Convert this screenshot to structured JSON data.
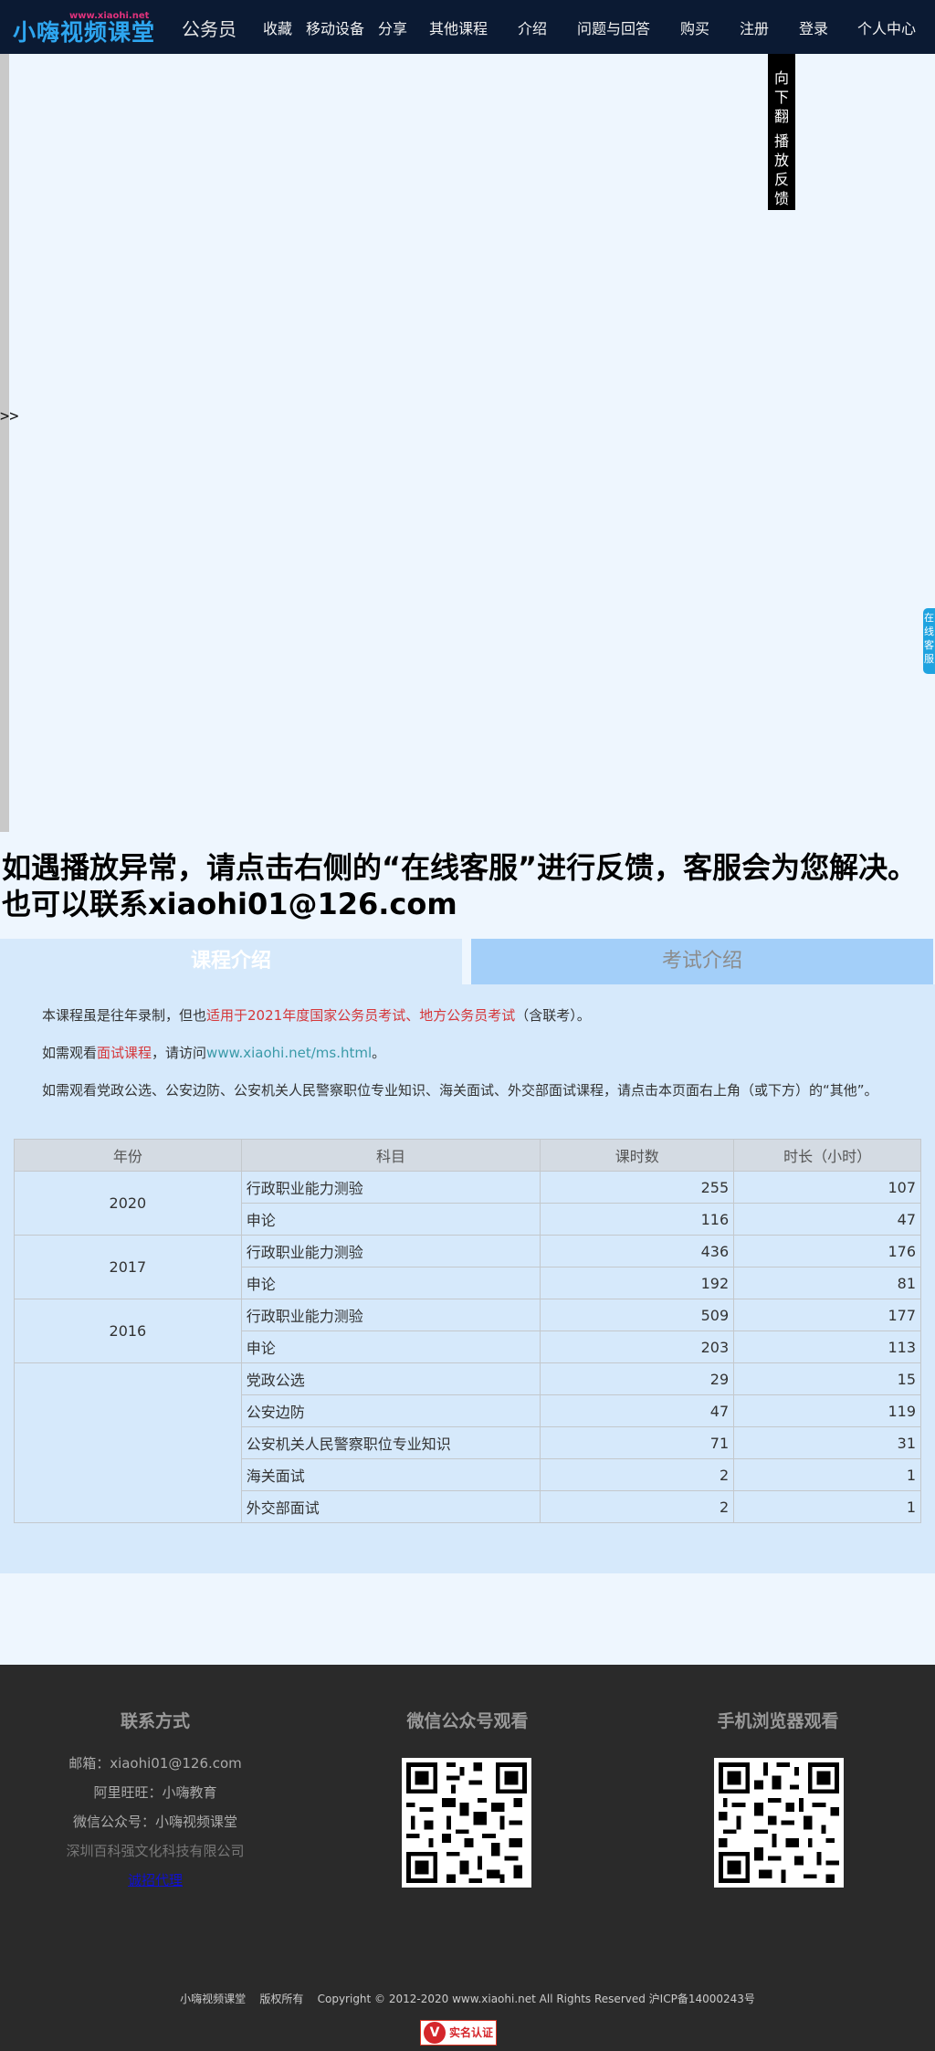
{
  "header": {
    "logo_text": "小嗨视频课堂",
    "logo_url": "www.xiaohi.net",
    "category": "公务员",
    "nav": [
      "收藏",
      "移动设备",
      "分享",
      "其他课程",
      "介绍",
      "问题与回答",
      "购买",
      "注册",
      "登录",
      "个人中心"
    ]
  },
  "player": {
    "toggle": ">>",
    "side_menu": [
      "向下翻",
      "播放反馈"
    ],
    "online_service": "在线客服"
  },
  "notice": {
    "line1": "如遇播放异常，请点击右侧的“在线客服”进行反馈，客服会为您解决。",
    "line2": "也可以联系xiaohi01@126.com"
  },
  "tabs": {
    "course": "课程介绍",
    "exam": "考试介绍"
  },
  "intro": {
    "p1_pre": "本课程虽是往年录制，但也",
    "p1_red": "适用于2021年度国家公务员考试、地方公务员考试",
    "p1_post": "（含联考）。",
    "p2_pre": "如需观看",
    "p2_red": "面试课程",
    "p2_mid": "，请访问",
    "p2_link": "www.xiaohi.net/ms.html",
    "p2_post": "。",
    "p3": "如需观看党政公选、公安边防、公安机关人民警察职位专业知识、海关面试、外交部面试课程，请点击本页面右上角（或下方）的“其他”。"
  },
  "table": {
    "headers": [
      "年份",
      "科目",
      "课时数",
      "时长（小时）"
    ],
    "groups": [
      {
        "year": "2020",
        "rows": [
          [
            "行政职业能力测验",
            "255",
            "107"
          ],
          [
            "申论",
            "116",
            "47"
          ]
        ]
      },
      {
        "year": "2017",
        "rows": [
          [
            "行政职业能力测验",
            "436",
            "176"
          ],
          [
            "申论",
            "192",
            "81"
          ]
        ]
      },
      {
        "year": "2016",
        "rows": [
          [
            "行政职业能力测验",
            "509",
            "177"
          ],
          [
            "申论",
            "203",
            "113"
          ]
        ]
      },
      {
        "year": "",
        "rows": [
          [
            "党政公选",
            "29",
            "15"
          ],
          [
            "公安边防",
            "47",
            "119"
          ],
          [
            "公安机关人民警察职位专业知识",
            "71",
            "31"
          ],
          [
            "海关面试",
            "2",
            "1"
          ],
          [
            "外交部面试",
            "2",
            "1"
          ]
        ]
      }
    ]
  },
  "footer": {
    "contact_title": "联系方式",
    "email": "邮箱：xiaohi01@126.com",
    "wangwang": "阿里旺旺：小嗨教育",
    "wechat": "微信公众号：小嗨视频课堂",
    "company": "深圳百科强文化科技有限公司",
    "agent": "诚招代理",
    "wechat_title": "微信公众号观看",
    "mobile_title": "手机浏览器观看",
    "copyright": "小嗨视频课堂    版权所有    Copyright © 2012-2020 www.xiaohi.net All Rights Reserved 沪ICP备14000243号",
    "badge": "实名认证"
  }
}
